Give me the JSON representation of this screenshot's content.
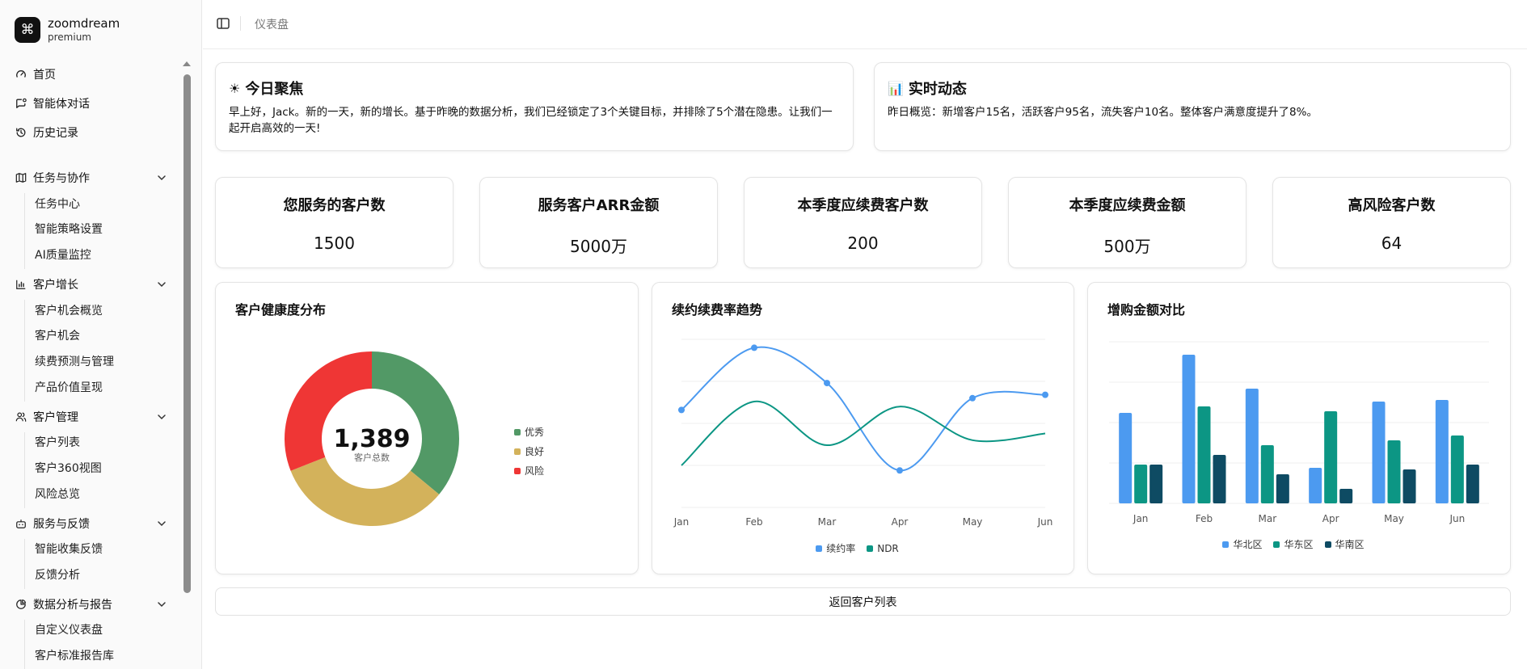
{
  "brand": {
    "logo_glyph": "⌘",
    "name": "zoomdream",
    "plan": "premium"
  },
  "sidebar": {
    "top_items": [
      {
        "label": "首页",
        "icon": "gauge-icon"
      },
      {
        "label": "智能体对话",
        "icon": "chat-icon"
      },
      {
        "label": "历史记录",
        "icon": "history-icon"
      }
    ],
    "groups": [
      {
        "label": "任务与协作",
        "icon": "map-icon",
        "children": [
          "任务中心",
          "智能策略设置",
          "AI质量监控"
        ]
      },
      {
        "label": "客户增长",
        "icon": "bar-chart-icon",
        "children": [
          "客户机会概览",
          "客户机会",
          "续费预测与管理",
          "产品价值呈现"
        ]
      },
      {
        "label": "客户管理",
        "icon": "users-icon",
        "children": [
          "客户列表",
          "客户360视图",
          "风险总览"
        ]
      },
      {
        "label": "服务与反馈",
        "icon": "bot-icon",
        "children": [
          "智能收集反馈",
          "反馈分析"
        ]
      },
      {
        "label": "数据分析与报告",
        "icon": "pie-chart-icon",
        "children": [
          "自定义仪表盘",
          "客户标准报告库"
        ]
      }
    ]
  },
  "header": {
    "breadcrumb": "仪表盘"
  },
  "focus": {
    "title": "今日聚焦",
    "emoji": "☀",
    "text": "早上好，Jack。新的一天，新的增长。基于昨晚的数据分析，我们已经锁定了3个关键目标，并排除了5个潜在隐患。让我们一起开启高效的一天!"
  },
  "realtime": {
    "title": "实时动态",
    "emoji": "📊",
    "text": "昨日概览：新增客户15名，活跃客户95名，流失客户10名。整体客户满意度提升了8%。"
  },
  "metrics": [
    {
      "title": "您服务的客户数",
      "value": "1500"
    },
    {
      "title": "服务客户ARR金额",
      "value": "5000万"
    },
    {
      "title": "本季度应续费客户数",
      "value": "200"
    },
    {
      "title": "本季度应续费金额",
      "value": "500万"
    },
    {
      "title": "高风险客户数",
      "value": "64"
    }
  ],
  "health": {
    "title": "客户健康度分布",
    "center_value": "1,389",
    "center_label": "客户总数",
    "chart_data": {
      "type": "pie",
      "categories": [
        "优秀",
        "良好",
        "风险"
      ],
      "values": [
        0.36,
        0.33,
        0.31
      ],
      "colors": [
        "#529966",
        "#D3B25B",
        "#EF3635"
      ]
    }
  },
  "renewal": {
    "title": "续约续费率趋势",
    "chart_data": {
      "type": "line",
      "x": [
        "Jan",
        "Feb",
        "Mar",
        "Apr",
        "May",
        "Jun"
      ],
      "ylim": [
        0,
        100
      ],
      "series": [
        {
          "name": "续约率",
          "values": [
            58,
            95,
            74,
            22,
            65,
            67
          ],
          "color": "#4C9AF0"
        },
        {
          "name": "NDR",
          "values": [
            25,
            63,
            37,
            60,
            40,
            44
          ],
          "color": "#0C9684"
        }
      ]
    }
  },
  "upsell": {
    "title": "增购金额对比",
    "chart_data": {
      "type": "bar",
      "categories": [
        "Jan",
        "Feb",
        "Mar",
        "Apr",
        "May",
        "Jun"
      ],
      "ylim": [
        0,
        100
      ],
      "series": [
        {
          "name": "华北区",
          "values": [
            56,
            92,
            71,
            22,
            63,
            64
          ],
          "color": "#4C9AF0"
        },
        {
          "name": "华东区",
          "values": [
            24,
            60,
            36,
            57,
            39,
            42
          ],
          "color": "#0C9684"
        },
        {
          "name": "华南区",
          "values": [
            24,
            30,
            18,
            9,
            21,
            24
          ],
          "color": "#0E4B63"
        }
      ]
    }
  },
  "back_button": "返回客户列表"
}
